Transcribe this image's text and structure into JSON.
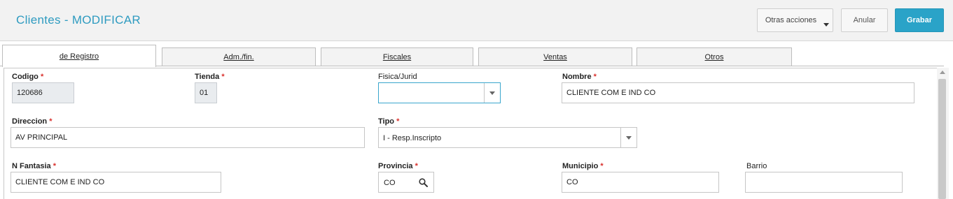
{
  "header": {
    "title": "Clientes - MODIFICAR",
    "buttons": {
      "otras_acciones": "Otras acciones",
      "anular": "Anular",
      "grabar": "Grabar"
    }
  },
  "tabs": [
    {
      "label": "de Registro",
      "active": true
    },
    {
      "label": "Adm./fin.",
      "active": false
    },
    {
      "label": "Fiscales",
      "active": false
    },
    {
      "label": "Ventas",
      "active": false
    },
    {
      "label": "Otros",
      "active": false
    }
  ],
  "form": {
    "codigo": {
      "label": "Codigo",
      "required": "*",
      "value": "120686"
    },
    "tienda": {
      "label": "Tienda",
      "required": "*",
      "value": "01"
    },
    "fisica_jurid": {
      "label": "Fisica/Jurid",
      "value": ""
    },
    "nombre": {
      "label": "Nombre",
      "required": "*",
      "value": "CLIENTE COM E IND CO"
    },
    "direccion": {
      "label": "Direccion",
      "required": "*",
      "value": "AV PRINCIPAL"
    },
    "tipo": {
      "label": "Tipo",
      "required": "*",
      "value": "I - Resp.Inscripto"
    },
    "n_fantasia": {
      "label": "N Fantasia",
      "required": "*",
      "value": "CLIENTE COM E IND CO"
    },
    "provincia": {
      "label": "Provincia",
      "required": "*",
      "value": "CO"
    },
    "municipio": {
      "label": "Municipio",
      "required": "*",
      "value": "CO"
    },
    "barrio": {
      "label": "Barrio",
      "value": ""
    }
  },
  "colors": {
    "title": "#2e9bc0",
    "primary_button": "#2aa3c8",
    "required_mark": "#d9302c",
    "focus_border": "#3aa6cd"
  }
}
